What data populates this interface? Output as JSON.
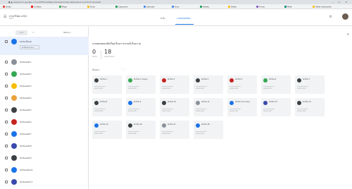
{
  "browser": {
    "tab_title": "● ▲ classroom.google.com/c/MTEx/a/MjIy/submissions/by-status/and-sort-first-name/all",
    "window_controls": "‒ ▢ ✕"
  },
  "bookmarks": [
    {
      "label": "Gmail",
      "color": "#ea4335"
    },
    {
      "label": "YouTube",
      "color": "#ff0000"
    },
    {
      "label": "Maps",
      "color": "#34a853"
    },
    {
      "label": "Drive",
      "color": "#fbbc04"
    },
    {
      "label": "Classroom",
      "color": "#0f9d58"
    },
    {
      "label": "Calendar",
      "color": "#4285f4"
    },
    {
      "label": "Docs",
      "color": "#4285f4"
    },
    {
      "label": "Sheets",
      "color": "#0f9d58"
    },
    {
      "label": "Slides",
      "color": "#fbbc04"
    },
    {
      "label": "Forms",
      "color": "#7e57c2"
    },
    {
      "label": "Meet",
      "color": "#00897b"
    },
    {
      "label": "Other bookmarks",
      "color": "#fbbc04"
    }
  ],
  "appbar": {
    "menu_icon": "☰",
    "class_name": "ภาษาไทย ป.5/1",
    "class_section": "2/65",
    "tabs": [
      {
        "label": "คำสั่ง",
        "active": false
      },
      {
        "label": "งานของนักเรียน",
        "active": true
      }
    ],
    "settings_icon": "⚙"
  },
  "sidebar": {
    "return_button": "ส่งคืน",
    "mail_icon": "✉",
    "sort_label": "จัดเรียง ▾",
    "items": [
      {
        "name": "นักเรียนทั้งหมด",
        "color": "#1a73e8",
        "selected": true,
        "sub": "ตัวเลือกคะแนน ▾"
      },
      {
        "name": "นักเรียนคนที่ 1",
        "color": "#8a9099",
        "selected": false
      },
      {
        "name": "นักเรียนคนที่ 2",
        "color": "#34a853",
        "selected": false
      },
      {
        "name": "นักเรียนคนที่ 3",
        "color": "#fbbc04",
        "selected": false
      },
      {
        "name": "นักเรียนคนที่ 4",
        "color": "#e8a33d",
        "selected": false
      },
      {
        "name": "นักเรียนคนที่ 5",
        "color": "#3c4043",
        "selected": false
      },
      {
        "name": "นักเรียนคนที่ 6",
        "color": "#c5221f",
        "selected": false
      },
      {
        "name": "นักเรียนคนที่ 7",
        "color": "#1a73e8",
        "selected": false
      },
      {
        "name": "นักเรียนคนที่ 8",
        "color": "#3949ab",
        "selected": false
      },
      {
        "name": "นักเรียนคนที่ 9",
        "color": "#3c4043",
        "selected": false
      },
      {
        "name": "นักเรียนคนที่ 10",
        "color": "#1a73e8",
        "selected": false
      },
      {
        "name": "นักเรียนคนที่ 11",
        "color": "#3949ab",
        "selected": false
      }
    ]
  },
  "main": {
    "assignment_title": "แบบทดสอบหลังเรียนเรื่องการอ่านจับใจความ",
    "stats": [
      {
        "value": "0",
        "label": "ส่งแล้ว"
      },
      {
        "value": "18",
        "label": "มอบหมายแล้ว"
      }
    ],
    "filter_label": "ทั้งหมด ▾",
    "folder_icon": "🗀",
    "cards": [
      {
        "name": "นักเรียน 1",
        "color": "#3c4043",
        "status": "มอบหมายแล้ว"
      },
      {
        "name": "นักเรียน 2 นามสกุล",
        "color": "#34a853",
        "status": "มอบหมายแล้ว"
      },
      {
        "name": "นักเรียน 3",
        "color": "#c5221f",
        "status": "มอบหมายแล้ว"
      },
      {
        "name": "นักเรียน 4",
        "color": "#3c4043",
        "status": "มอบหมายแล้ว"
      },
      {
        "name": "นักเรียน 5",
        "color": "#c5221f",
        "status": "มอบหมายแล้ว"
      },
      {
        "name": "นักเรียน 6",
        "color": "#34a853",
        "status": "มอบหมายแล้ว"
      },
      {
        "name": "นักเรียน 7",
        "color": "#3c4043",
        "status": "มอบหมายแล้ว"
      },
      {
        "name": "นักเรียน 8",
        "color": "#3c4043",
        "status": "มอบหมายแล้ว"
      },
      {
        "name": "นักเรียน 9",
        "color": "#1a73e8",
        "status": "มอบหมายแล้ว"
      },
      {
        "name": "นักเรียน 10",
        "color": "#3c4043",
        "status": "มอบหมายแล้ว"
      },
      {
        "name": "นักเรียน 11",
        "color": "#8a9099",
        "status": "มอบหมายแล้ว"
      },
      {
        "name": "นักเรียน 12 นามสกุล",
        "color": "#1a73e8",
        "status": "มอบหมายแล้ว"
      },
      {
        "name": "นักเรียน 13",
        "color": "#3949ab",
        "status": "มอบหมายแล้ว"
      },
      {
        "name": "นักเรียน 14",
        "color": "#3c4043",
        "status": "มอบหมายแล้ว"
      },
      {
        "name": "นักเรียน 15",
        "color": "#1a73e8",
        "status": "มอบหมายแล้ว"
      },
      {
        "name": "นักเรียน 16",
        "color": "#3c4043",
        "status": "มอบหมายแล้ว"
      },
      {
        "name": "นักเรียน 17",
        "color": "#8a9099",
        "status": "มอบหมายแล้ว"
      },
      {
        "name": "นักเรียน 18",
        "color": "#1a73e8",
        "status": "มอบหมายแล้ว"
      }
    ]
  }
}
